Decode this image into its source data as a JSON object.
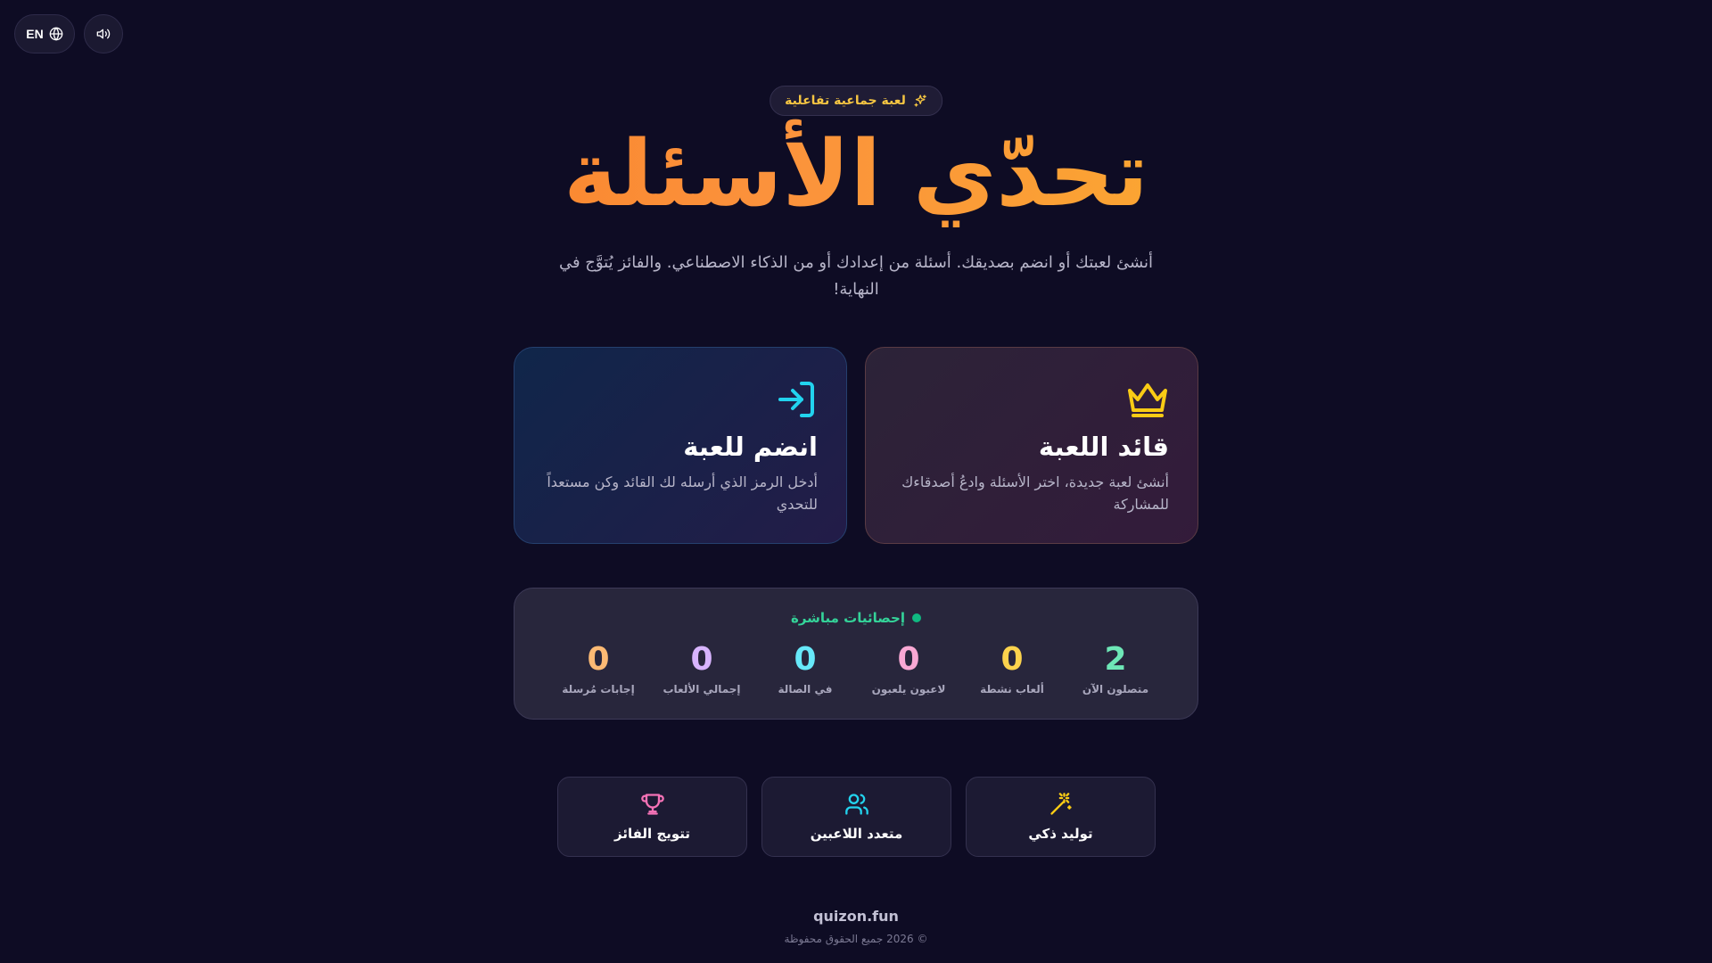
{
  "topbar": {
    "language_label": "EN",
    "language_icon": "globe-icon",
    "sound_icon": "speaker-icon"
  },
  "hero": {
    "badge_label": "لعبة جماعية تفاعلية",
    "badge_icon": "sparkles-icon",
    "title": "تحدّي الأسئلة",
    "subtitle": "أنشئ لعبتك أو انضم بصديقك. أسئلة من إعدادك أو من الذكاء الاصطناعي. والفائز يُتوَّج في النهاية!"
  },
  "cards": {
    "leader": {
      "icon": "crown-icon",
      "title": "قائد اللعبة",
      "description": "أنشئ لعبة جديدة، اختر الأسئلة وادعُ أصدقاءك للمشاركة",
      "accent": "#facc15"
    },
    "join": {
      "icon": "log-in-icon",
      "title": "انضم للعبة",
      "description": "أدخل الرمز الذي أرسله لك القائد وكن مستعداً للتحدي",
      "accent": "#22d3ee"
    }
  },
  "stats": {
    "header": "إحصائيات مباشرة",
    "items": [
      {
        "value": "2",
        "label": "متصلون الآن",
        "color": "#6ee7b7"
      },
      {
        "value": "0",
        "label": "ألعاب نشطة",
        "color": "#fcd34d"
      },
      {
        "value": "0",
        "label": "لاعبون يلعبون",
        "color": "#f9a8d4"
      },
      {
        "value": "0",
        "label": "في الصالة",
        "color": "#67e8f9"
      },
      {
        "value": "0",
        "label": "إجمالي الألعاب",
        "color": "#d8b4fe"
      },
      {
        "value": "0",
        "label": "إجابات مُرسلة",
        "color": "#fdba74"
      }
    ]
  },
  "features": [
    {
      "label": "توليد ذكي",
      "icon": "magic-wand-icon",
      "color": "#facc15"
    },
    {
      "label": "متعدد اللاعبين",
      "icon": "users-icon",
      "color": "#22d3ee"
    },
    {
      "label": "تتويج الفائز",
      "icon": "trophy-icon",
      "color": "#f472b6"
    }
  ],
  "footer": {
    "brand": "quizon.fun",
    "copyright": "© 2026 جميع الحقوق محفوظة"
  }
}
